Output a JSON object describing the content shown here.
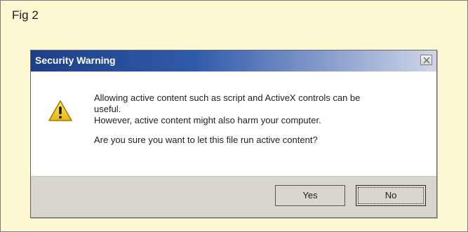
{
  "figure": {
    "label": "Fig 2"
  },
  "dialog": {
    "title": "Security Warning",
    "close_icon": "close-icon",
    "warning_icon": "warning-icon",
    "message_lines": [
      "Allowing active content such as script and ActiveX controls can be",
      "useful.",
      "However, active content might also harm your computer."
    ],
    "question": "Are you sure you want to let this file run active content?",
    "buttons": {
      "yes": "Yes",
      "no": "No"
    }
  },
  "colors": {
    "page_background": "#fdf7d2",
    "titlebar_start": "#1e3f86",
    "titlebar_end": "#cfd7e8",
    "footer": "#d9d6ce",
    "warning_yellow": "#f2cd2b"
  }
}
